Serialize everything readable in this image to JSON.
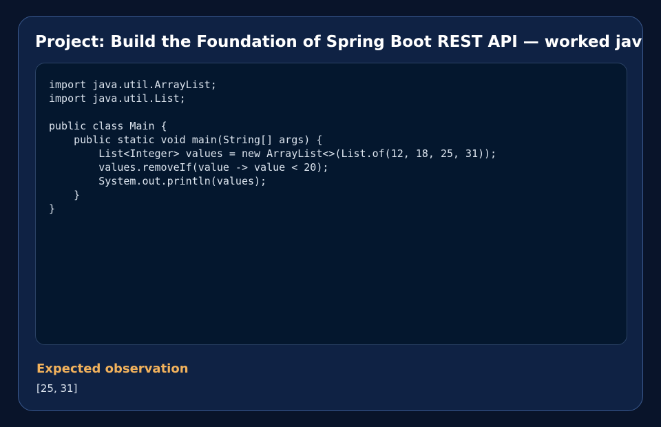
{
  "page": {
    "title": "Project: Build the Foundation of Spring Boot REST API — worked java"
  },
  "code": {
    "language": "java",
    "lines": [
      "import java.util.ArrayList;",
      "import java.util.List;",
      "",
      "public class Main {",
      "    public static void main(String[] args) {",
      "        List<Integer> values = new ArrayList<>(List.of(12, 18, 25, 31));",
      "        values.removeIf(value -> value < 20);",
      "        System.out.println(values);",
      "    }",
      "}"
    ]
  },
  "observation": {
    "label": "Expected observation",
    "value": "[25, 31]"
  },
  "colors": {
    "background": "#09142a",
    "card": "#0f2244",
    "code_panel": "#04172e",
    "accent": "#f2b25c",
    "title_text": "#ffffff",
    "body_text": "#dce4ee"
  }
}
